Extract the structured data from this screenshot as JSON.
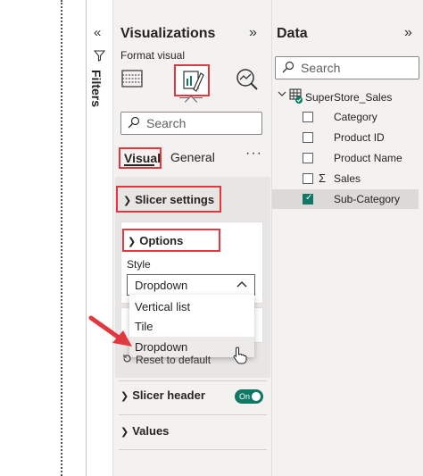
{
  "filters": {
    "label": "Filters",
    "collapse_icon": "double-chevron-left-icon",
    "funnel_icon": "funnel-icon"
  },
  "visualizations": {
    "title": "Visualizations",
    "expand_icon": "double-chevron-right-icon",
    "subtitle": "Format visual",
    "search_placeholder": "Search",
    "tabs": {
      "visual": "Visual",
      "general": "General",
      "more": "···"
    },
    "slicer_settings": "Slicer settings",
    "options": "Options",
    "style_label": "Style",
    "style_value": "Dropdown",
    "style_options": [
      "Vertical list",
      "Tile",
      "Dropdown"
    ],
    "reset": "Reset to default",
    "slicer_header": "Slicer header",
    "slicer_header_toggle": "On",
    "values": "Values"
  },
  "data_pane": {
    "title": "Data",
    "expand_icon": "double-chevron-right-icon",
    "search_placeholder": "Search",
    "table_name": "SuperStore_Sales",
    "fields": [
      {
        "label": "Category",
        "checked": false,
        "sigma": false
      },
      {
        "label": "Product ID",
        "checked": false,
        "sigma": false
      },
      {
        "label": "Product Name",
        "checked": false,
        "sigma": false
      },
      {
        "label": "Sales",
        "checked": false,
        "sigma": true
      },
      {
        "label": "Sub-Category",
        "checked": true,
        "sigma": false
      }
    ]
  },
  "colors": {
    "highlight": "#e0383e",
    "accent": "#117865",
    "pane_bg": "#f3f2f1"
  }
}
